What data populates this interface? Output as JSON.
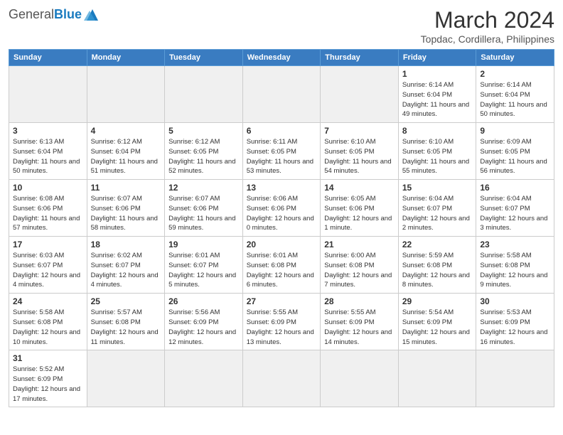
{
  "header": {
    "logo_general": "General",
    "logo_blue": "Blue",
    "month_year": "March 2024",
    "location": "Topdac, Cordillera, Philippines"
  },
  "days_of_week": [
    "Sunday",
    "Monday",
    "Tuesday",
    "Wednesday",
    "Thursday",
    "Friday",
    "Saturday"
  ],
  "weeks": [
    [
      {
        "day": "",
        "empty": true
      },
      {
        "day": "",
        "empty": true
      },
      {
        "day": "",
        "empty": true
      },
      {
        "day": "",
        "empty": true
      },
      {
        "day": "",
        "empty": true
      },
      {
        "day": "1",
        "sunrise": "6:14 AM",
        "sunset": "6:04 PM",
        "daylight": "11 hours and 49 minutes."
      },
      {
        "day": "2",
        "sunrise": "6:14 AM",
        "sunset": "6:04 PM",
        "daylight": "11 hours and 50 minutes."
      }
    ],
    [
      {
        "day": "3",
        "sunrise": "6:13 AM",
        "sunset": "6:04 PM",
        "daylight": "11 hours and 50 minutes."
      },
      {
        "day": "4",
        "sunrise": "6:12 AM",
        "sunset": "6:04 PM",
        "daylight": "11 hours and 51 minutes."
      },
      {
        "day": "5",
        "sunrise": "6:12 AM",
        "sunset": "6:05 PM",
        "daylight": "11 hours and 52 minutes."
      },
      {
        "day": "6",
        "sunrise": "6:11 AM",
        "sunset": "6:05 PM",
        "daylight": "11 hours and 53 minutes."
      },
      {
        "day": "7",
        "sunrise": "6:10 AM",
        "sunset": "6:05 PM",
        "daylight": "11 hours and 54 minutes."
      },
      {
        "day": "8",
        "sunrise": "6:10 AM",
        "sunset": "6:05 PM",
        "daylight": "11 hours and 55 minutes."
      },
      {
        "day": "9",
        "sunrise": "6:09 AM",
        "sunset": "6:05 PM",
        "daylight": "11 hours and 56 minutes."
      }
    ],
    [
      {
        "day": "10",
        "sunrise": "6:08 AM",
        "sunset": "6:06 PM",
        "daylight": "11 hours and 57 minutes."
      },
      {
        "day": "11",
        "sunrise": "6:07 AM",
        "sunset": "6:06 PM",
        "daylight": "11 hours and 58 minutes."
      },
      {
        "day": "12",
        "sunrise": "6:07 AM",
        "sunset": "6:06 PM",
        "daylight": "11 hours and 59 minutes."
      },
      {
        "day": "13",
        "sunrise": "6:06 AM",
        "sunset": "6:06 PM",
        "daylight": "12 hours and 0 minutes."
      },
      {
        "day": "14",
        "sunrise": "6:05 AM",
        "sunset": "6:06 PM",
        "daylight": "12 hours and 1 minute."
      },
      {
        "day": "15",
        "sunrise": "6:04 AM",
        "sunset": "6:07 PM",
        "daylight": "12 hours and 2 minutes."
      },
      {
        "day": "16",
        "sunrise": "6:04 AM",
        "sunset": "6:07 PM",
        "daylight": "12 hours and 3 minutes."
      }
    ],
    [
      {
        "day": "17",
        "sunrise": "6:03 AM",
        "sunset": "6:07 PM",
        "daylight": "12 hours and 4 minutes."
      },
      {
        "day": "18",
        "sunrise": "6:02 AM",
        "sunset": "6:07 PM",
        "daylight": "12 hours and 4 minutes."
      },
      {
        "day": "19",
        "sunrise": "6:01 AM",
        "sunset": "6:07 PM",
        "daylight": "12 hours and 5 minutes."
      },
      {
        "day": "20",
        "sunrise": "6:01 AM",
        "sunset": "6:08 PM",
        "daylight": "12 hours and 6 minutes."
      },
      {
        "day": "21",
        "sunrise": "6:00 AM",
        "sunset": "6:08 PM",
        "daylight": "12 hours and 7 minutes."
      },
      {
        "day": "22",
        "sunrise": "5:59 AM",
        "sunset": "6:08 PM",
        "daylight": "12 hours and 8 minutes."
      },
      {
        "day": "23",
        "sunrise": "5:58 AM",
        "sunset": "6:08 PM",
        "daylight": "12 hours and 9 minutes."
      }
    ],
    [
      {
        "day": "24",
        "sunrise": "5:58 AM",
        "sunset": "6:08 PM",
        "daylight": "12 hours and 10 minutes."
      },
      {
        "day": "25",
        "sunrise": "5:57 AM",
        "sunset": "6:08 PM",
        "daylight": "12 hours and 11 minutes."
      },
      {
        "day": "26",
        "sunrise": "5:56 AM",
        "sunset": "6:09 PM",
        "daylight": "12 hours and 12 minutes."
      },
      {
        "day": "27",
        "sunrise": "5:55 AM",
        "sunset": "6:09 PM",
        "daylight": "12 hours and 13 minutes."
      },
      {
        "day": "28",
        "sunrise": "5:55 AM",
        "sunset": "6:09 PM",
        "daylight": "12 hours and 14 minutes."
      },
      {
        "day": "29",
        "sunrise": "5:54 AM",
        "sunset": "6:09 PM",
        "daylight": "12 hours and 15 minutes."
      },
      {
        "day": "30",
        "sunrise": "5:53 AM",
        "sunset": "6:09 PM",
        "daylight": "12 hours and 16 minutes."
      }
    ],
    [
      {
        "day": "31",
        "sunrise": "5:52 AM",
        "sunset": "6:09 PM",
        "daylight": "12 hours and 17 minutes."
      },
      {
        "day": "",
        "empty": true
      },
      {
        "day": "",
        "empty": true
      },
      {
        "day": "",
        "empty": true
      },
      {
        "day": "",
        "empty": true
      },
      {
        "day": "",
        "empty": true
      },
      {
        "day": "",
        "empty": true
      }
    ]
  ]
}
